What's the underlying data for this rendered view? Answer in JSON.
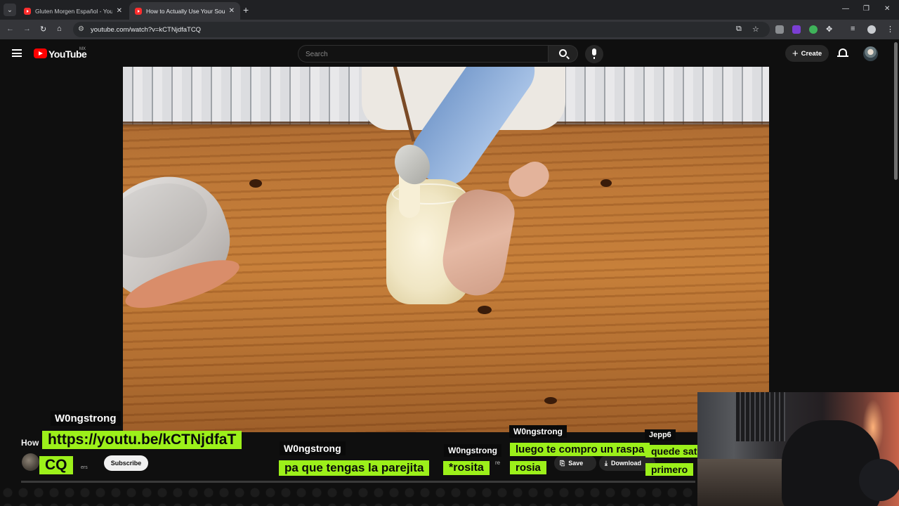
{
  "browser": {
    "tabs": [
      {
        "title": "Gluten Morgen Español - YouTube",
        "active": false
      },
      {
        "title": "How to Actually Use Your Sourdough Discard",
        "active": true
      }
    ],
    "new_tab": "+",
    "address": {
      "url": "youtube.com/watch?v=kCTNjdfaTCQ"
    }
  },
  "youtube": {
    "logo_text": "YouTube",
    "country": "MX",
    "search_placeholder": "Search",
    "create_label": "Create",
    "icons": [
      "menu-icon",
      "search-icon",
      "mic-icon",
      "plus-icon",
      "bell-icon"
    ]
  },
  "video_info": {
    "title_fragment": "How",
    "subs_fragment": "ers",
    "subscribe_label": "Subscribe",
    "share_fragment": "re",
    "save_label": "Save",
    "download_label": "Download"
  },
  "chat": [
    {
      "name": "W0ngstrong",
      "lines": [
        "https://youtu.be/kCTNjdfaT",
        "CQ"
      ]
    },
    {
      "name": "W0ngstrong",
      "lines": [
        "pa que tengas la parejita"
      ]
    },
    {
      "name": "W0ngstrong",
      "lines": [
        "*rosita"
      ]
    },
    {
      "name": "W0ngstrong",
      "lines": [
        "luego te compro un raspa",
        "rosia"
      ]
    },
    {
      "name": "Jepp6",
      "lines": [
        "quede satis",
        "primero"
      ]
    }
  ],
  "colors": {
    "chat_bubble": "#9cf01a",
    "yt_red": "#ff0000",
    "page_bg": "#0f0f0f"
  }
}
